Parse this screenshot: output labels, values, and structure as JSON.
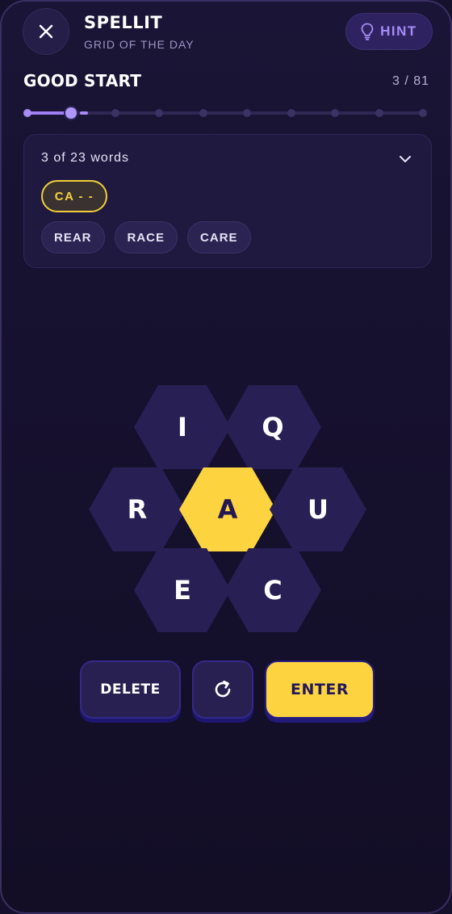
{
  "header": {
    "title": "SPELLIT",
    "subtitle": "GRID OF THE DAY",
    "hint_label": "HINT",
    "close_icon": "close-icon",
    "hint_icon": "lightbulb-icon"
  },
  "progress": {
    "rank": "GOOD START",
    "score": "3 / 81",
    "current": 3,
    "total": 81,
    "levels": 10,
    "current_level": 1
  },
  "words_panel": {
    "count_text": "3 of 23 words",
    "hint_pattern": "CA - -",
    "found": [
      "REAR",
      "RACE",
      "CARE"
    ],
    "expand_icon": "chevron-down-icon"
  },
  "board": {
    "center": "A",
    "outer": {
      "top_left": "I",
      "top_right": "Q",
      "left": "R",
      "right": "U",
      "bottom_left": "E",
      "bottom_right": "C"
    }
  },
  "actions": {
    "delete_label": "DELETE",
    "enter_label": "ENTER",
    "shuffle_icon": "shuffle-icon"
  },
  "colors": {
    "background": "#15102b",
    "accent": "#fdd440",
    "tile": "#281f55",
    "purple": "#a58cf5"
  }
}
